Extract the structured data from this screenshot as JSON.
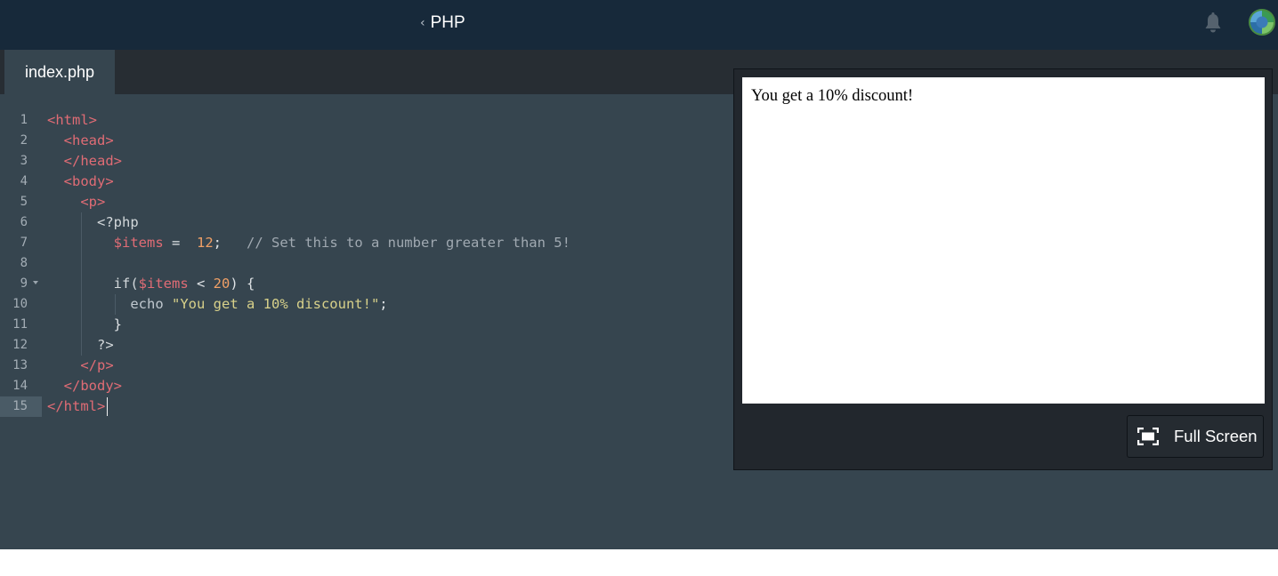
{
  "header": {
    "back_chevron": "‹",
    "title": "PHP",
    "bell_icon": "bell-icon",
    "avatar_icon": "avatar"
  },
  "tabs": [
    {
      "label": "index.php",
      "active": true
    }
  ],
  "editor": {
    "active_line": 15,
    "lines": [
      {
        "n": "1"
      },
      {
        "n": "2"
      },
      {
        "n": "3"
      },
      {
        "n": "4"
      },
      {
        "n": "5"
      },
      {
        "n": "6"
      },
      {
        "n": "7"
      },
      {
        "n": "8"
      },
      {
        "n": "9"
      },
      {
        "n": "10"
      },
      {
        "n": "11"
      },
      {
        "n": "12"
      },
      {
        "n": "13"
      },
      {
        "n": "14"
      },
      {
        "n": "15"
      }
    ],
    "tokens": {
      "html_open": "<html>",
      "head_open": "<head>",
      "head_close": "</head>",
      "body_open": "<body>",
      "p_open": "<p>",
      "php_open": "<?php",
      "items_var": "$items",
      "assign": " =  ",
      "items_value": "12",
      "semicolon": ";",
      "comment": "// Set this to a number greater than 5!",
      "if_kw": "if(",
      "items_var2": "$items",
      "lt": " < ",
      "limit_value": "20",
      "if_tail": ") {",
      "echo_kw": "echo",
      "echo_string": "\"You get a 10% discount!\"",
      "semicolon2": ";",
      "close_brace": "}",
      "php_close": "?>",
      "p_close": "</p>",
      "body_close": "</body>",
      "html_close": "</html>"
    }
  },
  "preview": {
    "output_text": "You get a 10% discount!",
    "fullscreen_label": "Full Screen",
    "fullscreen_icon": "fullscreen-icon"
  }
}
